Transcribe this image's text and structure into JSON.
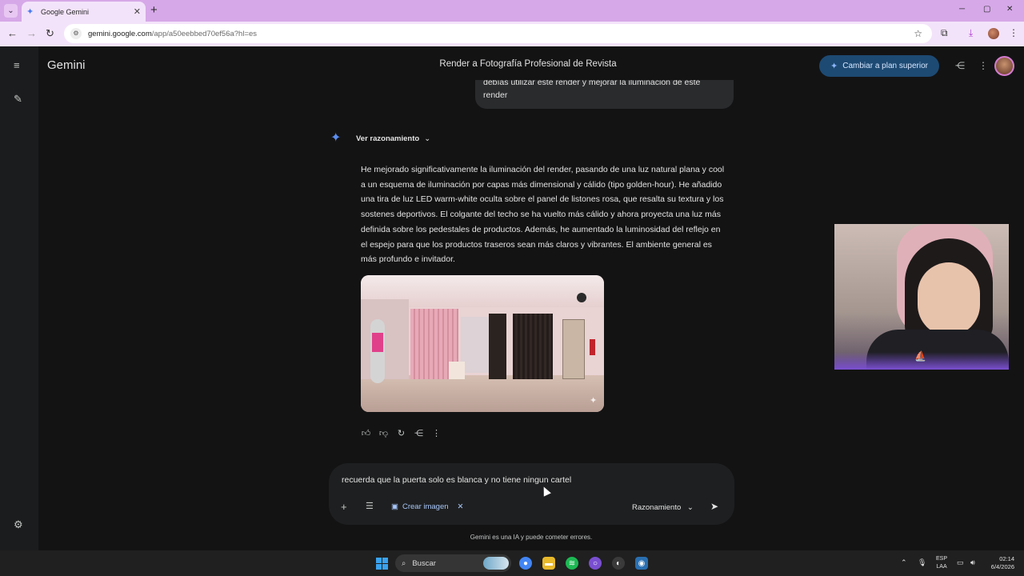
{
  "browser": {
    "tab_title": "Google Gemini",
    "url_host": "gemini.google.com",
    "url_path": "/app/a50eebbed70ef56a?hl=es"
  },
  "app": {
    "brand": "Gemini",
    "conversation_title": "Render a Fotografía Profesional de Revista",
    "upgrade_label": "Cambiar a plan superior"
  },
  "conversation": {
    "user_message_fragment_1": "debías utilizar este render y mejorar la iluminación de este",
    "user_message_fragment_2": "render",
    "reasoning_label": "Ver razonamiento",
    "answer_text": "He mejorado significativamente la iluminación del render, pasando de una luz natural plana y cool a un esquema de iluminación por capas más dimensional y cálido (tipo golden-hour). He añadido una tira de luz LED warm-white oculta sobre el panel de listones rosa, que resalta su textura y los sostenes deportivos. El colgante del techo se ha vuelto más cálido y ahora proyecta una luz más definida sobre los pedestales de productos. Además, he aumentado la luminosidad del reflejo en el espejo para que los productos traseros sean más claros y vibrantes. El ambiente general es más profundo e invitador."
  },
  "composer": {
    "prompt_value": "recuerda que la puerta solo es blanca y no tiene ningun cartel",
    "create_image_label": "Crear imagen",
    "mode_label": "Razonamiento"
  },
  "disclaimer": "Gemini es una IA y puede cometer errores.",
  "taskbar": {
    "search_label": "Buscar",
    "lang_line1": "ESP",
    "lang_line2": "LAA",
    "time": "02:14",
    "date": "6/4/2026"
  },
  "colors": {
    "tab_strip": "#d6a8e8",
    "app_bg": "#131314",
    "upgrade_bg": "#1d4a73",
    "accent_blue": "#a8c7fa"
  }
}
